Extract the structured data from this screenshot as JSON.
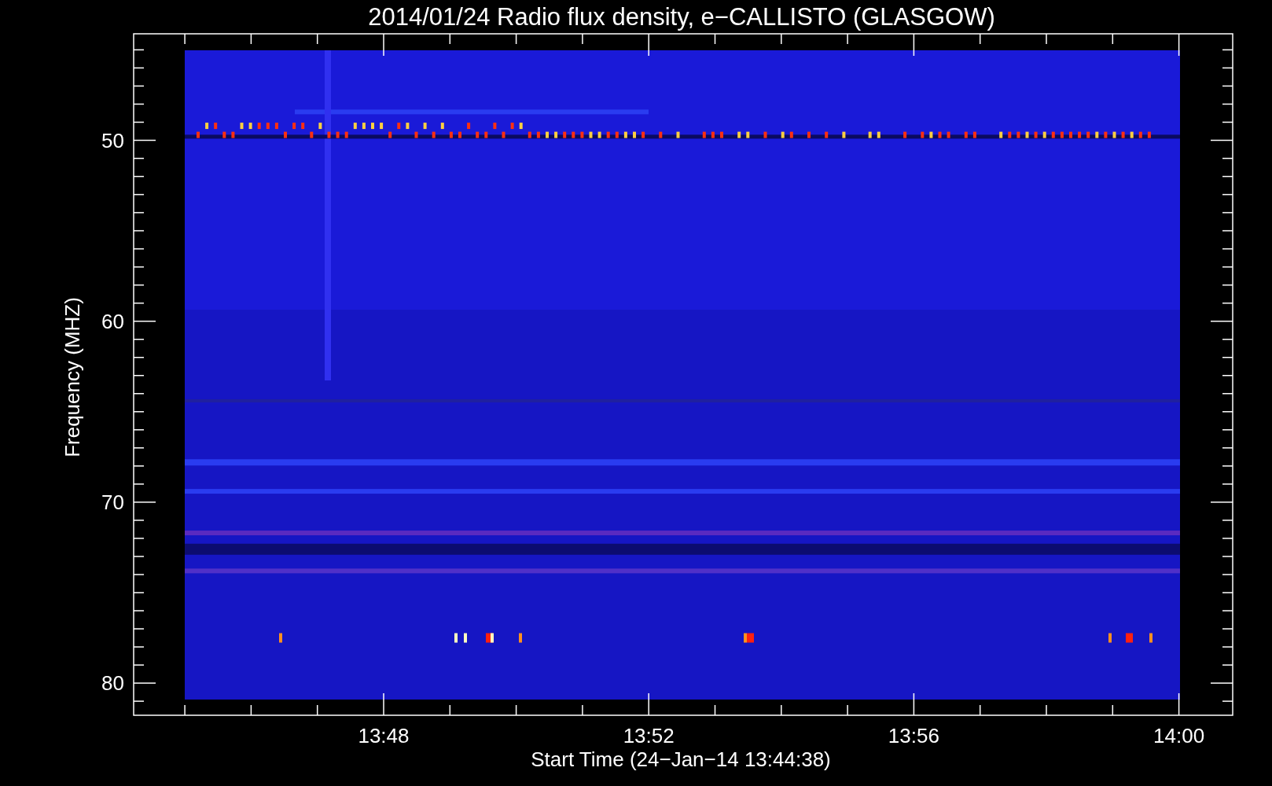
{
  "title": "2014/01/24  Radio flux density, e−CALLISTO (GLASGOW)",
  "plot": {
    "ylabel": "Frequency (MHZ)",
    "xlabel": "Start Time (24−Jan−14 13:44:38)",
    "yticks": [
      "50",
      "60",
      "70",
      "80"
    ],
    "xticks": [
      "13:48",
      "13:52",
      "13:56",
      "14:00"
    ]
  }
}
